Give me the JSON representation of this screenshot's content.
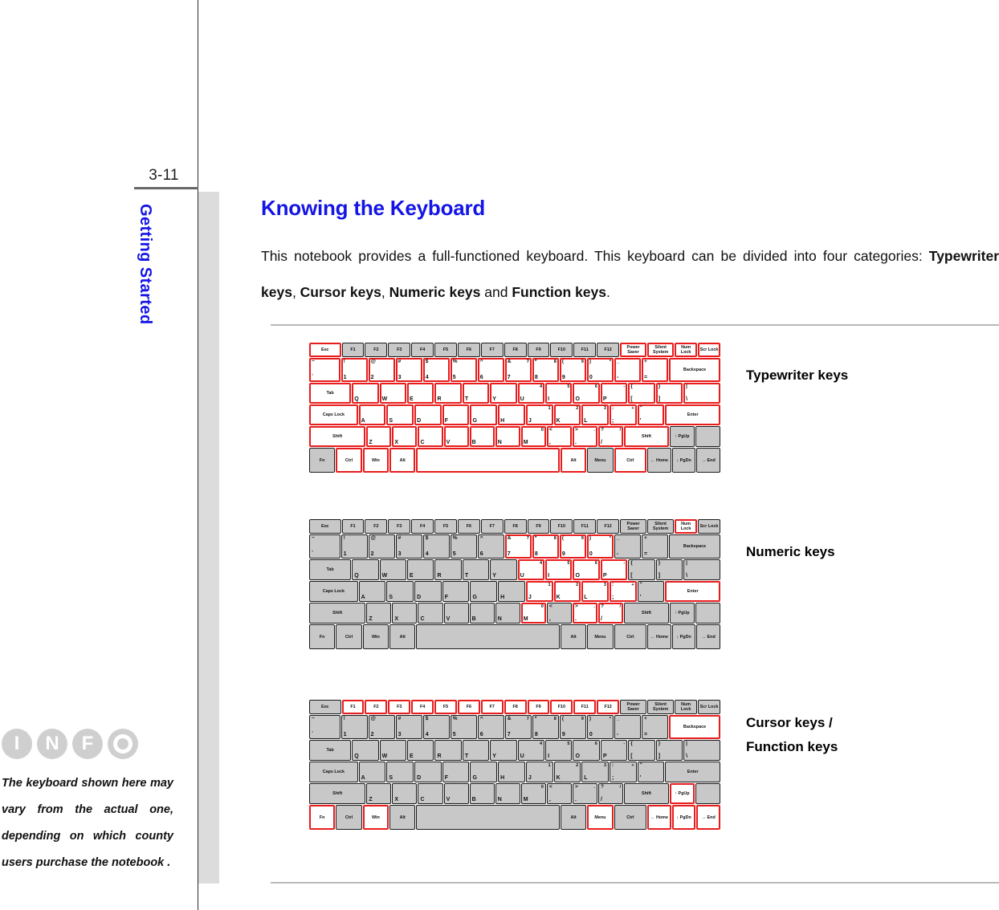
{
  "page": {
    "number": "3-11",
    "chapter_title": "Getting Started"
  },
  "section": {
    "title": "Knowing the Keyboard",
    "paragraph_plain": "This notebook provides a full-functioned keyboard.  This keyboard can be divided into four categories: ",
    "p_part1": "This  notebook  provides  a  full-functioned  keyboard.    This  keyboard  can  be  divided  into  four categories: ",
    "b_typewriter": "Typewriter keys",
    "sep1": ", ",
    "b_cursor": "Cursor keys",
    "sep2": ", ",
    "b_numeric": "Numeric keys",
    "sep3": " and ",
    "b_function": "Function keys",
    "sep4": "."
  },
  "figures": [
    {
      "caption_line1": "Typewriter keys",
      "caption_line2": ""
    },
    {
      "caption_line1": "Numeric keys",
      "caption_line2": ""
    },
    {
      "caption_line1": "Cursor keys /",
      "caption_line2": "Function keys"
    }
  ],
  "info": {
    "letters": [
      "I",
      "N",
      "F",
      "O"
    ],
    "text": "The keyboard shown here may vary from the actual one, depending on which county users purchase the notebook ."
  },
  "colors": {
    "accent_blue": "#1414e6",
    "highlight_red": "#e81c1c",
    "key_gray": "#c8c8c8",
    "band_gray": "#dcdcdc",
    "rule_gray": "#b9b9b9"
  },
  "keyboard": {
    "rows": [
      {
        "name": "function-row",
        "cls": "fnrow",
        "keys": [
          {
            "c": "Esc",
            "w": 1.45
          },
          {
            "c": "F1",
            "w": 1
          },
          {
            "c": "F2",
            "w": 1
          },
          {
            "c": "F3",
            "w": 1
          },
          {
            "c": "F4",
            "w": 1
          },
          {
            "c": "F5",
            "w": 1
          },
          {
            "c": "F6",
            "w": 1
          },
          {
            "c": "F7",
            "w": 1
          },
          {
            "c": "F8",
            "w": 1
          },
          {
            "c": "F9",
            "w": 1
          },
          {
            "c": "F10",
            "w": 1
          },
          {
            "c": "F11",
            "w": 1
          },
          {
            "c": "F12",
            "w": 1
          },
          {
            "c": "Power Saver",
            "w": 1.2
          },
          {
            "c": "Silent System",
            "w": 1.2
          },
          {
            "c": "Num Lock",
            "w": 1
          },
          {
            "c": "Scr Lock",
            "w": 1
          }
        ]
      },
      {
        "name": "number-row",
        "cls": "numrow",
        "keys": [
          {
            "tl": "~",
            "m": "`",
            "w": 1.18
          },
          {
            "tl": "!",
            "m": "1",
            "w": 1
          },
          {
            "tl": "@",
            "m": "2",
            "w": 1
          },
          {
            "tl": "#",
            "m": "3",
            "w": 1
          },
          {
            "tl": "$",
            "m": "4",
            "w": 1
          },
          {
            "tl": "%",
            "m": "5",
            "w": 1
          },
          {
            "tl": "^",
            "m": "6",
            "w": 1
          },
          {
            "tl": "&",
            "m": "7",
            "tr": "7",
            "w": 1
          },
          {
            "tl": "*",
            "m": "8",
            "tr": "8",
            "w": 1
          },
          {
            "tl": "(",
            "m": "9",
            "tr": "9",
            "w": 1
          },
          {
            "tl": ")",
            "m": "0",
            "tr": "*",
            "w": 1
          },
          {
            "tl": "_",
            "m": "-",
            "w": 1
          },
          {
            "tl": "+",
            "m": "=",
            "w": 1
          },
          {
            "c": "Backspace",
            "w": 2.0
          }
        ]
      },
      {
        "name": "qwerty-row",
        "cls": "qrow",
        "keys": [
          {
            "c": "Tab",
            "w": 1.6
          },
          {
            "m": "Q",
            "w": 1
          },
          {
            "m": "W",
            "w": 1
          },
          {
            "m": "E",
            "w": 1
          },
          {
            "m": "R",
            "w": 1
          },
          {
            "m": "T",
            "w": 1
          },
          {
            "m": "Y",
            "w": 1
          },
          {
            "m": "U",
            "tr": "4",
            "w": 1
          },
          {
            "m": "I",
            "tr": "5",
            "w": 1
          },
          {
            "m": "O",
            "tr": "6",
            "w": 1
          },
          {
            "m": "P",
            "tr": "-",
            "w": 1
          },
          {
            "tl": "{",
            "m": "[",
            "w": 1
          },
          {
            "tl": "}",
            "m": "]",
            "w": 1
          },
          {
            "tl": "|",
            "m": "\\",
            "w": 1.4
          }
        ]
      },
      {
        "name": "home-row",
        "cls": "hrow",
        "keys": [
          {
            "c": "Caps Lock",
            "w": 1.85
          },
          {
            "m": "A",
            "w": 1
          },
          {
            "m": "S",
            "w": 1
          },
          {
            "m": "D",
            "w": 1
          },
          {
            "m": "F",
            "w": 1
          },
          {
            "m": "G",
            "w": 1
          },
          {
            "m": "H",
            "w": 1
          },
          {
            "m": "J",
            "tr": "1",
            "w": 1
          },
          {
            "m": "K",
            "tr": "2",
            "w": 1
          },
          {
            "m": "L",
            "tr": "3",
            "w": 1
          },
          {
            "tl": ":",
            "m": ";",
            "tr": "+",
            "w": 1
          },
          {
            "tl": "\"",
            "m": "'",
            "w": 1
          },
          {
            "c": "Enter",
            "w": 2.1
          }
        ]
      },
      {
        "name": "shift-row",
        "cls": "srow",
        "keys": [
          {
            "c": "Shift",
            "w": 2.35
          },
          {
            "m": "Z",
            "w": 1
          },
          {
            "m": "X",
            "w": 1
          },
          {
            "m": "C",
            "w": 1
          },
          {
            "m": "V",
            "w": 1
          },
          {
            "m": "B",
            "w": 1
          },
          {
            "m": "N",
            "w": 1
          },
          {
            "m": "M",
            "tr": "0",
            "w": 1
          },
          {
            "tl": "<",
            "m": ",",
            "w": 1
          },
          {
            "tl": ">",
            "m": ".",
            "tr": ".",
            "w": 1
          },
          {
            "tl": "?",
            "m": "/",
            "tr": "/",
            "w": 1
          },
          {
            "c": "Shift",
            "w": 1.85
          },
          {
            "c": "↑ PgUp",
            "w": 1
          },
          {
            "c": "",
            "w": 1
          }
        ]
      },
      {
        "name": "bottom-row",
        "cls": "botrow",
        "keys": [
          {
            "c": "Fn",
            "w": 1.1
          },
          {
            "c": "Ctrl",
            "w": 1.1
          },
          {
            "c": "Win",
            "w": 1.1
          },
          {
            "c": "Alt",
            "w": 1.1
          },
          {
            "c": "",
            "w": 6.4
          },
          {
            "c": "Alt",
            "w": 1.1
          },
          {
            "c": "Menu",
            "w": 1.1
          },
          {
            "c": "Ctrl",
            "w": 1.4
          },
          {
            "c": "← Home",
            "w": 1
          },
          {
            "c": "↓ PgDn",
            "w": 1
          },
          {
            "c": "→ End",
            "w": 1
          }
        ]
      }
    ],
    "highlight_sets": {
      "typewriter": {
        "number-row": "all",
        "qwerty-row": "all",
        "home-row": "all",
        "shift-row": "0,1,2,3,4,5,6,7,8,9,10,11",
        "bottom-row": "1,2,3,4,5,7",
        "function-row": "0,13,14,15,16"
      },
      "numeric": {
        "number-row": "7,8,9,10",
        "qwerty-row": "7,8,9,10",
        "home-row": "7,8,9,10,12",
        "shift-row": "7,9,10",
        "function-row": "15"
      },
      "cursor": {
        "function-row": "1,2,3,4,5,6,7,8,9,10,11,12",
        "number-row": "13",
        "shift-row": "12",
        "bottom-row": "0,2,6,8,9,10"
      }
    }
  }
}
